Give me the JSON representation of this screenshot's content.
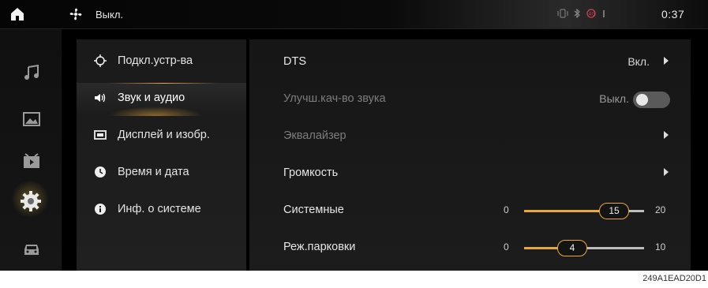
{
  "statusbar": {
    "fan_status": "Выкл.",
    "clock": "0:37",
    "status_icons": [
      "phone-vibrate-icon",
      "bluetooth-icon",
      "4g-signal-icon"
    ]
  },
  "leftbar": {
    "items": [
      {
        "icon": "music-icon"
      },
      {
        "icon": "gallery-icon"
      },
      {
        "icon": "video-icon"
      },
      {
        "icon": "settings-gear-icon",
        "active": true
      },
      {
        "icon": "car-icon"
      }
    ]
  },
  "menu": {
    "items": [
      {
        "label": "Подкл.устр-ва",
        "icon": "connection-icon"
      },
      {
        "label": "Звук и аудио",
        "icon": "speaker-icon",
        "active": true
      },
      {
        "label": "Дисплей и изобр.",
        "icon": "display-icon"
      },
      {
        "label": "Время и дата",
        "icon": "clock-icon"
      },
      {
        "label": "Инф. о системе",
        "icon": "info-icon"
      }
    ]
  },
  "panel": {
    "dts": {
      "label": "DTS",
      "value": "Вкл."
    },
    "sound_quality": {
      "label": "Улучш.кач-во звука",
      "value": "Выкл.",
      "toggle_on": false
    },
    "equalizer": {
      "label": "Эквалайзер"
    },
    "volume": {
      "label": "Громкость"
    },
    "system_volume": {
      "label": "Системные",
      "min": "0",
      "max": "20",
      "value": "15",
      "range_max": 20
    },
    "parking_volume": {
      "label": "Реж.парковки",
      "min": "0",
      "max": "10",
      "value": "4",
      "range_max": 10
    }
  },
  "caption": "249A1EAD20D1",
  "colors": {
    "accent": "#e8a83c",
    "background": "#000000"
  }
}
